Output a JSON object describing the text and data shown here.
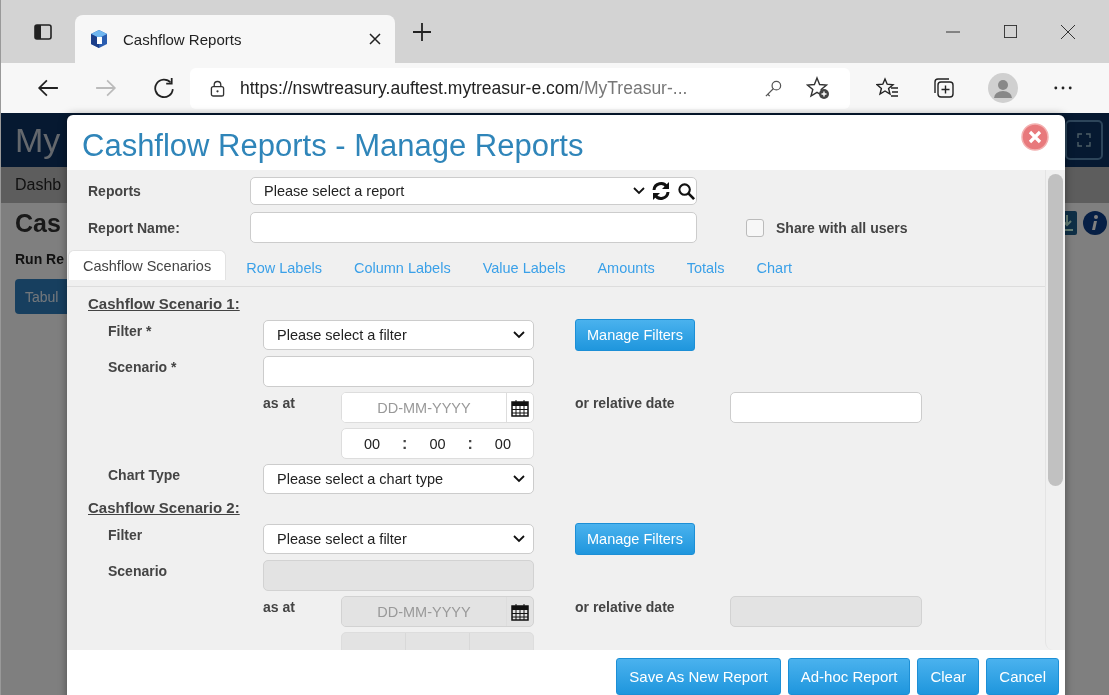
{
  "browser": {
    "tab_title": "Cashflow Reports",
    "url_main": "https://nswtreasury.auftest.mytreasur-e.com",
    "url_rest": "/MyTreasur-..."
  },
  "background_page": {
    "brand": "My",
    "nav_item": "Dashb",
    "heading": "Cas",
    "subheading": "Run Re",
    "button": "Tabul"
  },
  "dialog": {
    "title": "Cashflow Reports - Manage Reports",
    "reports": {
      "label": "Reports",
      "value": "Please select a report"
    },
    "report_name": {
      "label": "Report Name:"
    },
    "share": {
      "label": "Share with all users",
      "checked": false
    },
    "tabs": [
      {
        "label": "Cashflow Scenarios",
        "selected": true
      },
      {
        "label": "Row Labels",
        "selected": false
      },
      {
        "label": "Column Labels",
        "selected": false
      },
      {
        "label": "Value Labels",
        "selected": false
      },
      {
        "label": "Amounts",
        "selected": false
      },
      {
        "label": "Totals",
        "selected": false
      },
      {
        "label": "Chart",
        "selected": false
      }
    ],
    "scenarios": [
      {
        "heading": "Cashflow Scenario 1:",
        "filter": {
          "label": "Filter *",
          "value": "Please select a filter",
          "disabled": false
        },
        "manage_button": "Manage Filters",
        "scenario": {
          "label": "Scenario *",
          "disabled": false
        },
        "as_at": {
          "label": "as at",
          "placeholder": "DD-MM-YYYY",
          "disabled": false
        },
        "relative": {
          "label": "or relative date",
          "disabled": false
        },
        "time": {
          "hours": "00",
          "minutes": "00",
          "seconds": "00",
          "separator": ":",
          "disabled": false
        },
        "chart_type": {
          "label": "Chart Type",
          "value": "Please select a chart type"
        }
      },
      {
        "heading": "Cashflow Scenario 2:",
        "filter": {
          "label": "Filter",
          "value": "Please select a filter",
          "disabled": false
        },
        "manage_button": "Manage Filters",
        "scenario": {
          "label": "Scenario",
          "disabled": true
        },
        "as_at": {
          "label": "as at",
          "placeholder": "DD-MM-YYYY",
          "disabled": true
        },
        "relative": {
          "label": "or relative date",
          "disabled": true
        },
        "time": {
          "disabled": true
        }
      }
    ],
    "buttons": [
      "Save As New Report",
      "Ad-hoc Report",
      "Clear",
      "Cancel"
    ]
  }
}
